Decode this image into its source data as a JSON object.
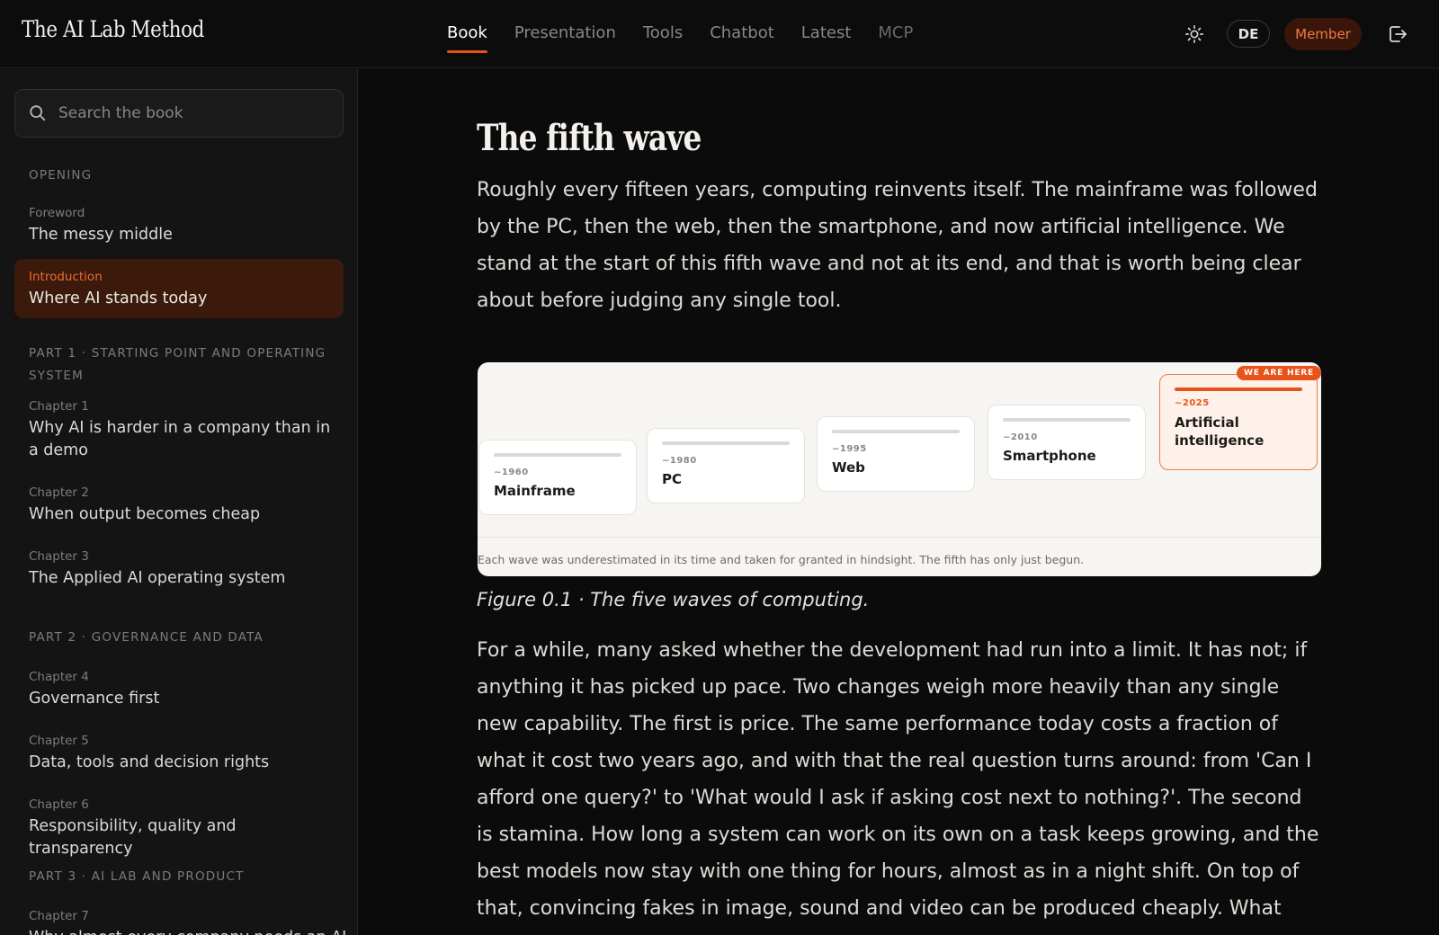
{
  "header": {
    "brand": "The AI Lab Method",
    "nav": [
      {
        "label": "Book",
        "active": true
      },
      {
        "label": "Presentation",
        "active": false
      },
      {
        "label": "Tools",
        "active": false
      },
      {
        "label": "Chatbot",
        "active": false
      },
      {
        "label": "Latest",
        "active": false
      },
      {
        "label": "MCP",
        "active": false
      }
    ],
    "theme_icon": "sun-icon",
    "language": "DE",
    "member_label": "Member",
    "logout_icon": "logout-icon"
  },
  "sidebar": {
    "search_placeholder": "Search the book",
    "sections": [
      {
        "heading": "OPENING",
        "items": [
          {
            "kicker": "Foreword",
            "title": "The messy middle"
          },
          {
            "kicker": "Introduction",
            "title": "Where AI stands today",
            "active": true
          }
        ]
      },
      {
        "heading": "PART 1 · STARTING POINT AND OPERATING SYSTEM",
        "items": [
          {
            "kicker": "Chapter 1",
            "title": "Why AI is harder in a company than in a demo"
          },
          {
            "kicker": "Chapter 2",
            "title": "When output becomes cheap"
          },
          {
            "kicker": "Chapter 3",
            "title": "The Applied AI operating system"
          }
        ]
      },
      {
        "heading": "PART 2 · GOVERNANCE AND DATA",
        "items": [
          {
            "kicker": "Chapter 4",
            "title": "Governance first"
          },
          {
            "kicker": "Chapter 5",
            "title": "Data, tools and decision rights"
          },
          {
            "kicker": "Chapter 6",
            "title": "Responsibility, quality and transparency"
          }
        ]
      },
      {
        "heading": "PART 3 · AI LAB AND PRODUCT",
        "items": [
          {
            "kicker": "Chapter 7",
            "title": "Why almost every company needs an AI"
          }
        ]
      }
    ]
  },
  "main": {
    "title": "The fifth wave",
    "paragraph1": "Roughly every fifteen years, computing reinvents itself. The mainframe was followed by the PC, then the web, then the smartphone, and now artificial intelligence. We stand at the start of this fifth wave and not at its end, and that is worth being clear about before judging any single tool.",
    "figure": {
      "waves": [
        {
          "year": "~1960",
          "name": "Mainframe"
        },
        {
          "year": "~1980",
          "name": "PC"
        },
        {
          "year": "~1995",
          "name": "Web"
        },
        {
          "year": "~2010",
          "name": "Smartphone"
        },
        {
          "year": "~2025",
          "name": "Artificial intelligence",
          "current": true
        }
      ],
      "badge": "WE ARE HERE",
      "note": "Each wave was underestimated in its time and taken for granted in hindsight. The fifth has only just begun."
    },
    "caption": "Figure 0.1 · The five waves of computing.",
    "paragraph2": "For a while, many asked whether the development had run into a limit. It has not; if anything it has picked up pace. Two changes weigh more heavily than any single new capability. The first is price. The same performance today costs a fraction of what it cost two years ago, and with that the real question turns around: from 'Can I afford one query?' to 'What would I ask if asking cost next to nothing?'. The second is stamina. How long a system can work on its own on a task keeps growing, and the best models now stay with one thing for hours, almost as in a night shift. On top of that, convincing fakes in image, sound and video can be produced cheaply. What you set aside"
  }
}
